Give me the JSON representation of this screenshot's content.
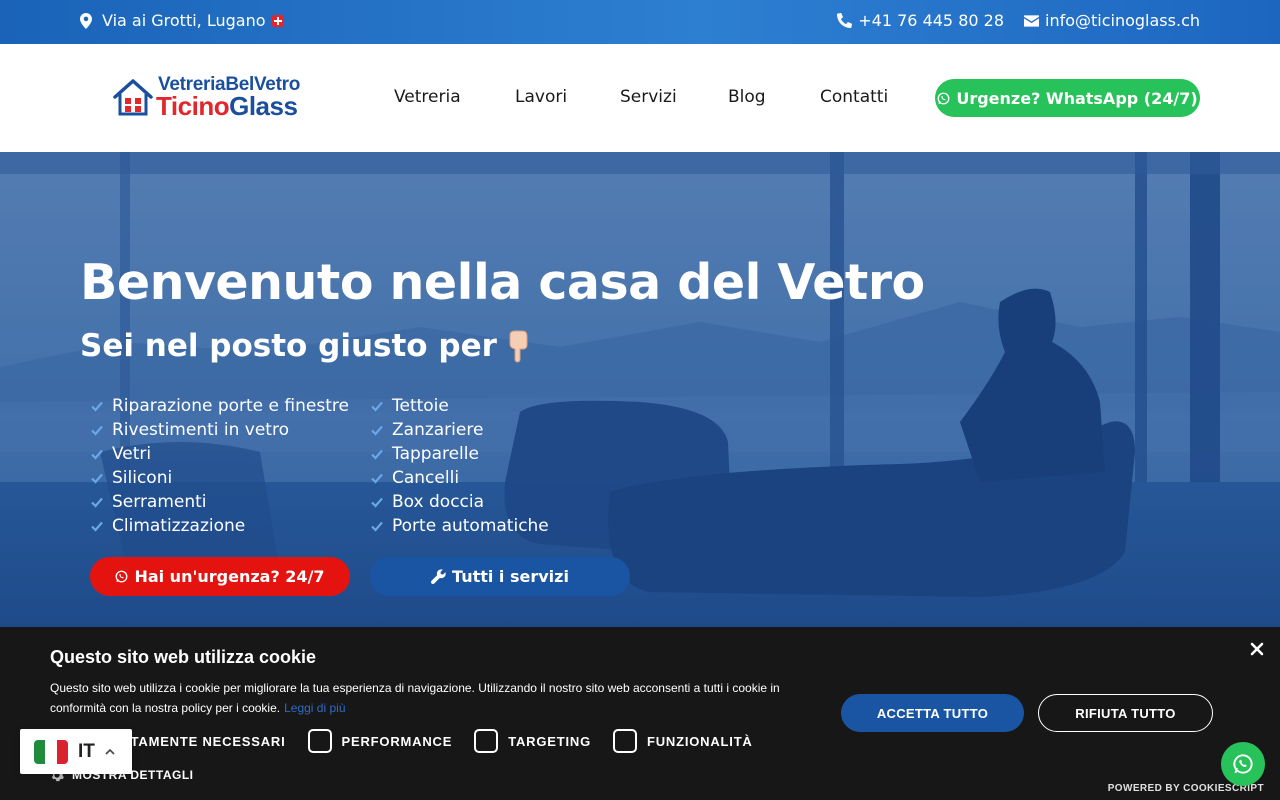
{
  "topbar": {
    "address": "Via ai Grotti, Lugano",
    "phone": "+41 76 445 80 28",
    "email": "info@ticinoglass.ch"
  },
  "logo": {
    "line1": "VetreriaBelVetro",
    "line2_a": "Ticino",
    "line2_b": "Glass"
  },
  "nav": {
    "items": [
      "Vetreria",
      "Lavori",
      "Servizi",
      "Blog",
      "Contatti"
    ],
    "cta": "Urgenze? WhatsApp (24/7)"
  },
  "hero": {
    "title": "Benvenuto nella casa del Vetro",
    "subtitle": "Sei nel posto giusto per",
    "services_col1": [
      "Riparazione porte e finestre",
      "Rivestimenti in vetro",
      "Vetri",
      "Siliconi",
      "Serramenti",
      "Climatizzazione"
    ],
    "services_col2": [
      "Tettoie",
      "Zanzariere",
      "Tapparelle",
      "Cancelli",
      "Box doccia",
      "Porte automatiche"
    ],
    "btn_urgent": "Hai un'urgenza? 24/7",
    "btn_services": "Tutti i servizi"
  },
  "cookie": {
    "title": "Questo sito web utilizza cookie",
    "description": "Questo sito web utilizza i cookie per migliorare la tua esperienza di navigazione. Utilizzando il nostro sito web acconsenti a tutti i cookie in conformità con la nostra policy per i cookie.",
    "read_more": "Leggi di più",
    "accept": "ACCETTA TUTTO",
    "reject": "RIFIUTA TUTTO",
    "categories": [
      "STRETTAMENTE NECESSARI",
      "PERFORMANCE",
      "TARGETING",
      "FUNZIONALITÀ"
    ],
    "show_details": "MOSTRA DETTAGLI",
    "powered_by": "POWERED BY COOKIESCRIPT"
  },
  "language": {
    "code": "IT"
  },
  "colors": {
    "brand_blue": "#1a55a3",
    "whatsapp_green": "#27c25a",
    "urgent_red": "#e5130f",
    "cookie_bg": "#171717"
  }
}
